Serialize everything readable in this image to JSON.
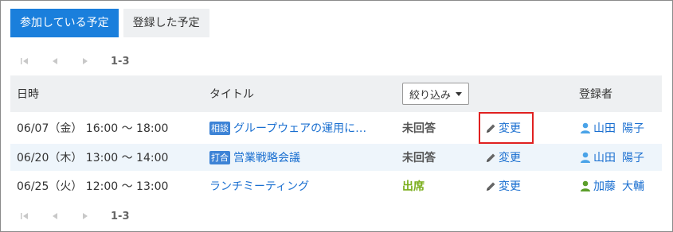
{
  "tabs": [
    {
      "label": "参加している予定",
      "active": true
    },
    {
      "label": "登録した予定",
      "active": false
    }
  ],
  "pager": {
    "range": "1-3"
  },
  "table": {
    "headers": {
      "date": "日時",
      "title": "タイトル",
      "filter": "絞り込み",
      "registrant": "登録者"
    },
    "rows": [
      {
        "date": "06/07（金） 16:00 ～ 18:00",
        "badge": "相談",
        "title": "グループウェアの運用に…",
        "status": "未回答",
        "edit": "変更",
        "family": "山田",
        "given": "陽子",
        "user_icon_color": "#4aa3e8"
      },
      {
        "date": "06/20（木） 13:00 ～ 14:00",
        "badge": "打合",
        "title": "営業戦略会議",
        "status": "未回答",
        "edit": "変更",
        "family": "山田",
        "given": "陽子",
        "user_icon_color": "#4aa3e8"
      },
      {
        "date": "06/25（火） 12:00 ～ 13:00",
        "badge": "",
        "title": "ランチミーティング",
        "status": "出席",
        "edit": "変更",
        "family": "加藤",
        "given": "大輔",
        "user_icon_color": "#5b9e2a"
      }
    ]
  },
  "colors": {
    "accent": "#1a7fdc",
    "link": "#1a6fd0",
    "highlight": "#e02020",
    "attend": "#7aae1c"
  }
}
